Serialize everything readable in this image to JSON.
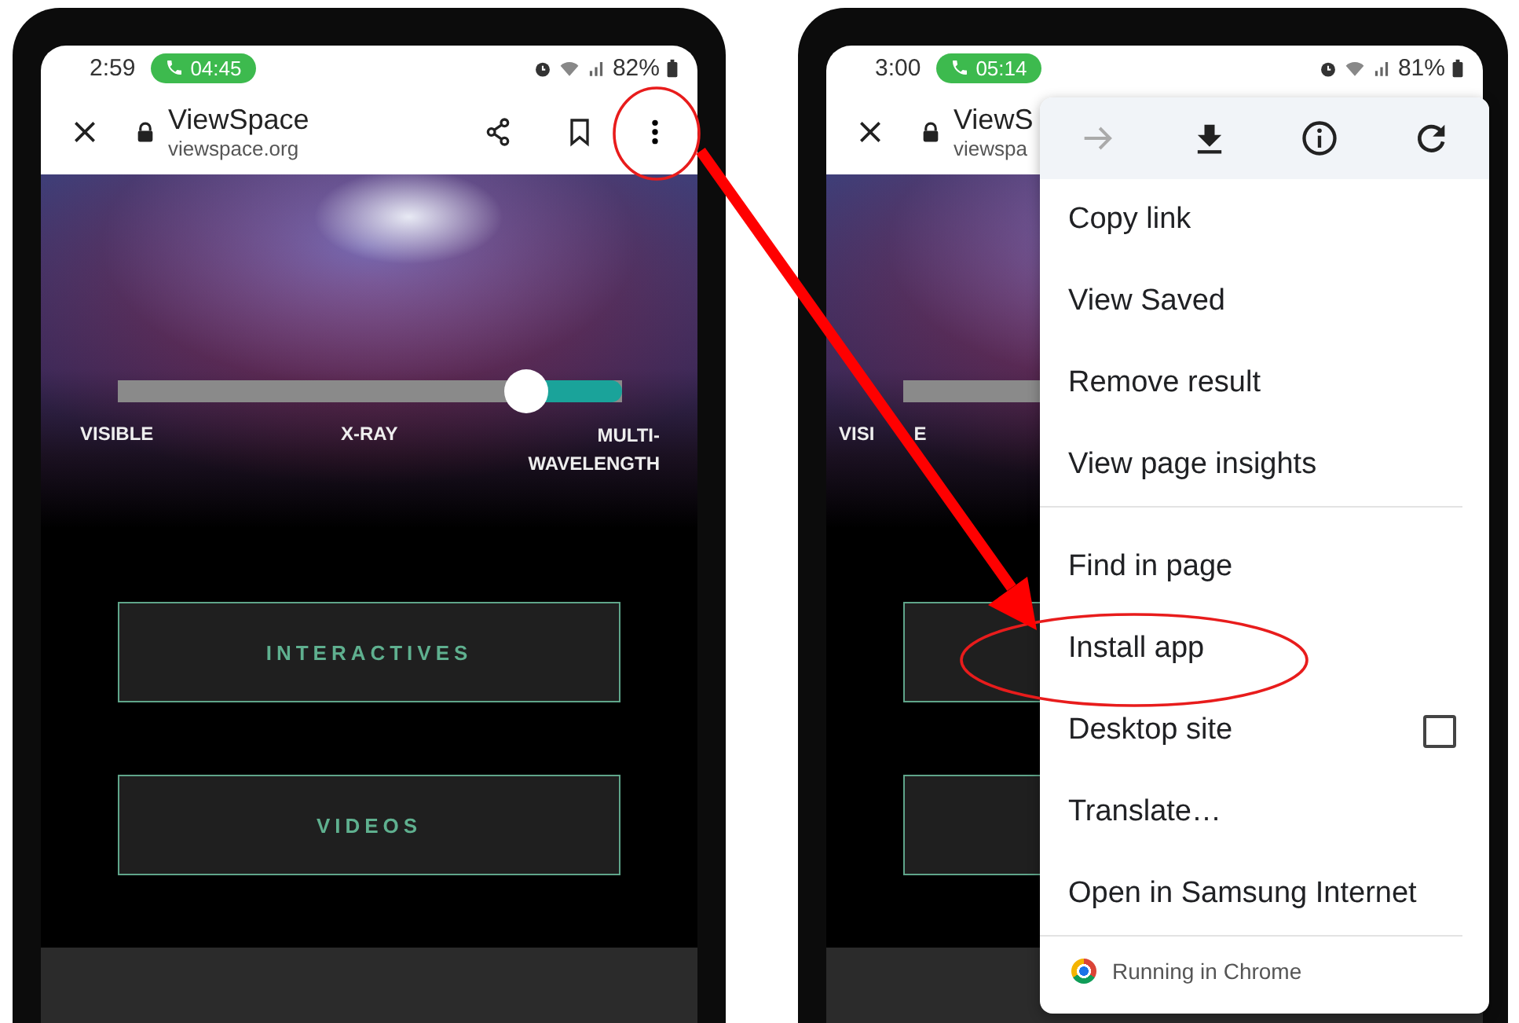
{
  "phones": [
    {
      "kind": "full",
      "status_bar": {
        "time": "2:59",
        "call_timer": "04:45",
        "battery": "82%"
      },
      "toolbar": {
        "title": "ViewSpace",
        "url": "viewspace.org"
      },
      "slider": {
        "level": 0.81,
        "labels": [
          "VISIBLE",
          "X-RAY",
          "MULTI-WAVELENGTH"
        ]
      },
      "buttons": [
        "INTERACTIVES",
        "VIDEOS"
      ]
    },
    {
      "kind": "covered",
      "status_bar": {
        "time": "3:00",
        "call_timer": "05:14",
        "battery": "81%"
      },
      "toolbar": {
        "title": "ViewS",
        "url": "viewspa"
      },
      "slider": {
        "labels": [
          "VISI",
          "E"
        ]
      }
    }
  ],
  "menu": {
    "icons": [
      {
        "kind": "forward",
        "disabled": true
      },
      {
        "kind": "download",
        "disabled": false
      },
      {
        "kind": "info",
        "disabled": false
      },
      {
        "kind": "refresh",
        "disabled": false
      }
    ],
    "groups": [
      [
        {
          "kind": "item",
          "label": "Copy link"
        },
        {
          "kind": "item",
          "label": "View Saved"
        },
        {
          "kind": "item",
          "label": "Remove result"
        },
        {
          "kind": "item",
          "label": "View page insights"
        }
      ],
      [
        {
          "kind": "item",
          "label": "Find in page"
        },
        {
          "kind": "item",
          "label": "Install app"
        },
        {
          "kind": "checkbox",
          "label": "Desktop site",
          "checked": false
        },
        {
          "kind": "item",
          "label": "Translate…"
        },
        {
          "kind": "item",
          "label": "Open in Samsung Internet"
        }
      ]
    ],
    "footer": "Running in Chrome"
  }
}
